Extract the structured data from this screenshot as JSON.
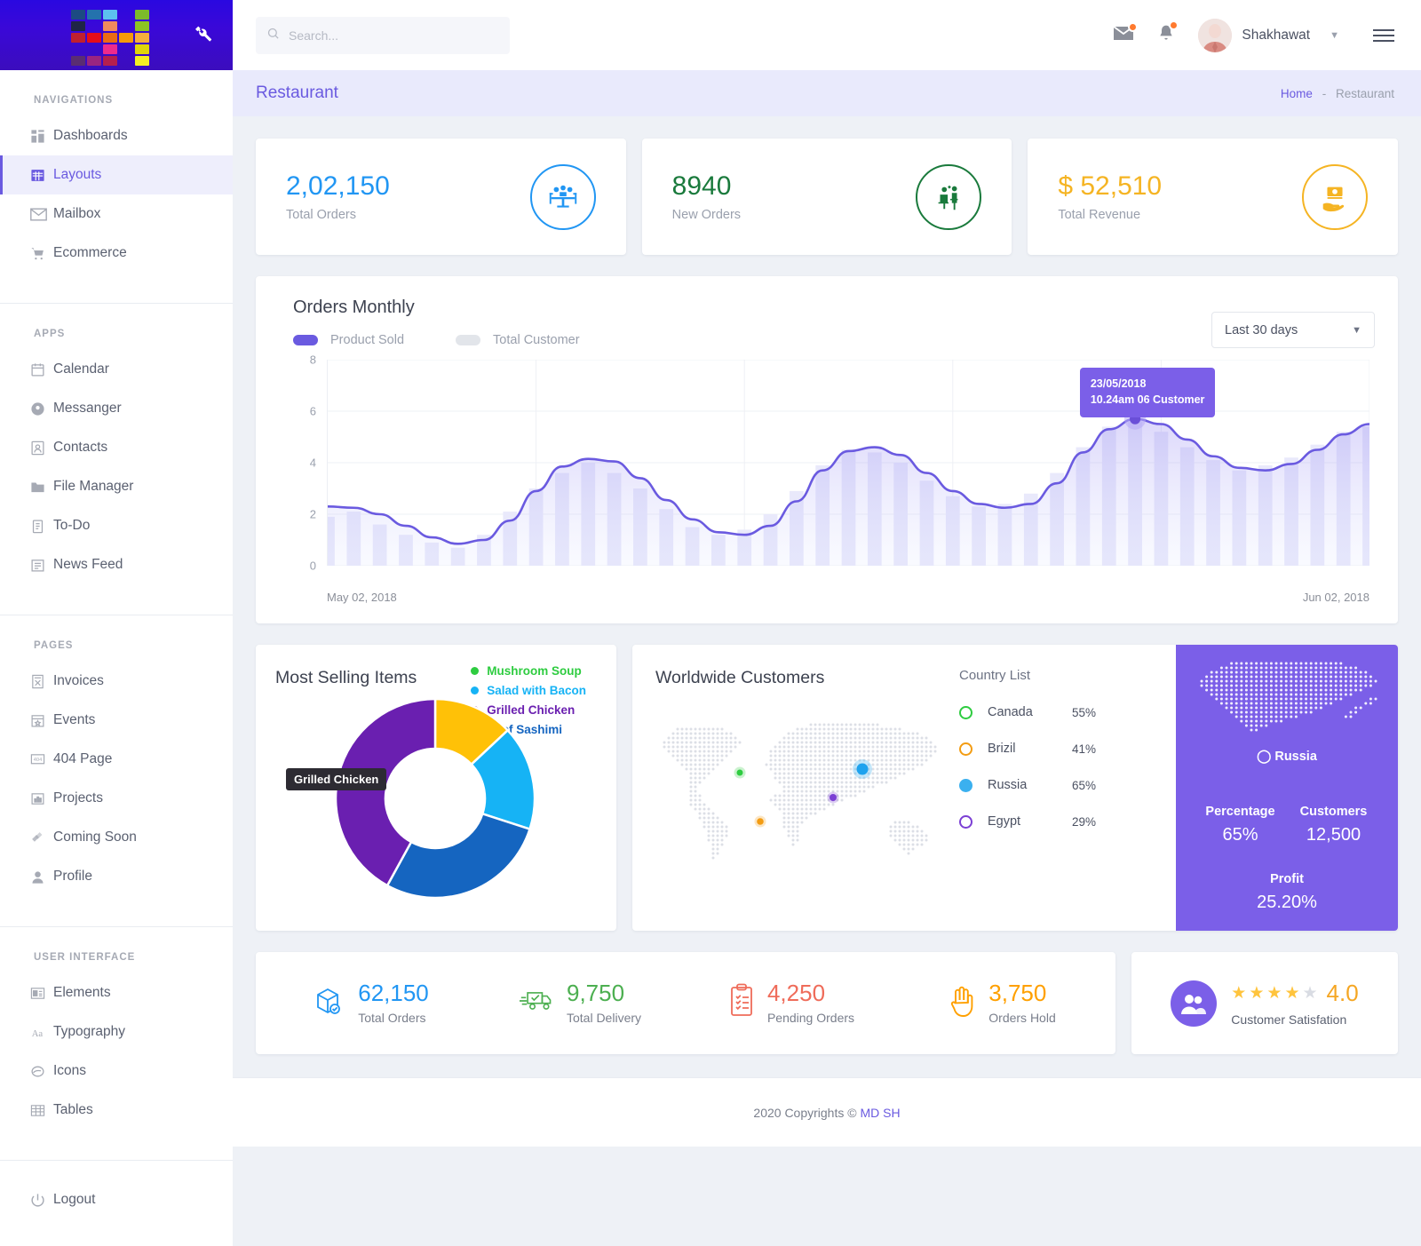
{
  "brand": {
    "logo_name": "logo-grid",
    "wrench": "✕"
  },
  "sidebar": {
    "sections": [
      {
        "label": "NAVIGATIONS",
        "items": [
          {
            "label": "Dashboards",
            "icon": "dashboard-icon",
            "active": false
          },
          {
            "label": "Layouts",
            "icon": "layouts-icon",
            "active": true
          },
          {
            "label": "Mailbox",
            "icon": "mail-icon",
            "active": false
          },
          {
            "label": "Ecommerce",
            "icon": "cart-icon",
            "active": false
          }
        ]
      },
      {
        "label": "APPS",
        "items": [
          {
            "label": "Calendar",
            "icon": "calendar-icon",
            "active": false
          },
          {
            "label": "Messanger",
            "icon": "messenger-icon",
            "active": false
          },
          {
            "label": "Contacts",
            "icon": "contacts-icon",
            "active": false
          },
          {
            "label": "File Manager",
            "icon": "folder-icon",
            "active": false
          },
          {
            "label": "To-Do",
            "icon": "todo-icon",
            "active": false
          },
          {
            "label": "News Feed",
            "icon": "news-icon",
            "active": false
          }
        ]
      },
      {
        "label": "PAGES",
        "items": [
          {
            "label": "Invoices",
            "icon": "invoice-icon",
            "active": false
          },
          {
            "label": "Events",
            "icon": "events-icon",
            "active": false
          },
          {
            "label": "404 Page",
            "icon": "error-page-icon",
            "active": false
          },
          {
            "label": "Projects",
            "icon": "projects-icon",
            "active": false
          },
          {
            "label": "Coming Soon",
            "icon": "coming-soon-icon",
            "active": false
          },
          {
            "label": "Profile",
            "icon": "profile-icon",
            "active": false
          }
        ]
      },
      {
        "label": "USER INTERFACE",
        "items": [
          {
            "label": "Elements",
            "icon": "elements-icon",
            "active": false
          },
          {
            "label": "Typography",
            "icon": "typography-icon",
            "active": false
          },
          {
            "label": "Icons",
            "icon": "icons-icon",
            "active": false
          },
          {
            "label": "Tables",
            "icon": "tables-icon",
            "active": false
          }
        ]
      }
    ],
    "logout": {
      "label": "Logout",
      "icon": "power-icon"
    }
  },
  "topbar": {
    "search_placeholder": "Search...",
    "search_value": "",
    "mail_icon": "envelope-icon",
    "bell_icon": "bell-icon",
    "user_name": "Shakhawat",
    "caret": "▼",
    "menu_icon": "hamburger-icon"
  },
  "pagehead": {
    "title": "Restaurant",
    "breadcrumb_home": "Home",
    "breadcrumb_sep": "-",
    "breadcrumb_current": "Restaurant"
  },
  "stat_cards": [
    {
      "value": "2,02,150",
      "label": "Total Orders",
      "color": "#2196f3",
      "icon": "dining-table-icon"
    },
    {
      "value": "8940",
      "label": "New Orders",
      "color": "#1a7a3c",
      "icon": "waiter-icon"
    },
    {
      "value": "$ 52,510",
      "label": "Total Revenue",
      "color": "#f5b423",
      "icon": "money-hand-icon"
    }
  ],
  "orders_monthly": {
    "title": "Orders Monthly",
    "legend": [
      {
        "label": "Product Sold",
        "color": "#6a5ae0"
      },
      {
        "label": "Total Customer",
        "color": "#e2e5ea"
      }
    ],
    "range_label": "Last 30 days",
    "range_caret": "▼",
    "tooltip": {
      "date": "23/05/2018",
      "detail": "10.24am  06 Customer"
    },
    "start_date": "May 02, 2018",
    "end_date": "Jun 02, 2018"
  },
  "chart_data": [
    {
      "type": "area",
      "title": "Orders Monthly",
      "xlabel": "",
      "ylabel": "",
      "ylim": [
        0,
        8
      ],
      "yticks": [
        0,
        2,
        4,
        6,
        8
      ],
      "grid": true,
      "legend_position": "top-left",
      "x": [
        "May 02, 2018",
        "Jun 02, 2018"
      ],
      "series": [
        {
          "name": "Product Sold",
          "color": "#6a5ae0",
          "values": [
            2.3,
            2.25,
            2.0,
            1.55,
            1.1,
            0.85,
            1.0,
            1.75,
            2.9,
            3.85,
            4.15,
            4.05,
            3.4,
            2.55,
            1.8,
            1.3,
            1.2,
            1.55,
            2.5,
            3.7,
            4.45,
            4.6,
            4.3,
            3.6,
            2.9,
            2.4,
            2.25,
            2.4,
            3.2,
            4.4,
            5.3,
            5.7,
            5.5,
            4.9,
            4.25,
            3.8,
            3.7,
            3.95,
            4.5,
            5.1,
            5.5
          ]
        },
        {
          "name": "Total Customer",
          "color": "#e2e5ea",
          "values": [
            1.9,
            2.1,
            1.6,
            1.2,
            0.9,
            0.7,
            1.2,
            2.1,
            3.0,
            3.6,
            4.0,
            3.6,
            3.0,
            2.2,
            1.5,
            1.2,
            1.4,
            2.0,
            2.9,
            3.9,
            4.5,
            4.4,
            4.0,
            3.3,
            2.7,
            2.3,
            2.4,
            2.8,
            3.6,
            4.6,
            5.4,
            5.6,
            5.2,
            4.6,
            4.1,
            3.7,
            3.9,
            4.2,
            4.7,
            5.2,
            5.4
          ]
        }
      ],
      "annotation": {
        "x_index": 31,
        "y": 5.7,
        "text": "23/05/2018 10.24am  06 Customer"
      }
    },
    {
      "type": "pie",
      "title": "Most Selling Items",
      "donut": true,
      "labels": [
        "Mushroom Soup",
        "Salad with Bacon",
        "Grilled Chicken",
        "Beef Sashimi"
      ],
      "values": [
        13,
        17,
        42,
        28
      ],
      "colors": [
        "#ffc107",
        "#16b3f5",
        "#6a1fb0",
        "#1565c0"
      ],
      "legend_colors": [
        "#2ecc40",
        "#16b3f5",
        "#6a1fb0",
        "#1565c0"
      ],
      "legend_position": "top-right",
      "annotation": "Grilled Chicken"
    },
    {
      "type": "table",
      "title": "Worldwide Customers",
      "columns": [
        "Country",
        "Percentage"
      ],
      "rows": [
        [
          "Canada",
          "55%"
        ],
        [
          "Brizil",
          "41%"
        ],
        [
          "Russia",
          "65%"
        ],
        [
          "Egypt",
          "29%"
        ]
      ],
      "colors": [
        "#2ecc40",
        "#f39c12",
        "#3bb0ef",
        "#7b3fd4"
      ]
    }
  ],
  "most_selling": {
    "title": "Most Selling Items",
    "tooltip": "Grilled Chicken",
    "legend": [
      {
        "label": "Mushroom Soup",
        "color": "#2ecc40"
      },
      {
        "label": "Salad with Bacon",
        "color": "#16b3f5"
      },
      {
        "label": "Grilled Chicken",
        "color": "#6a1fb0"
      },
      {
        "label": "Beef Sashimi",
        "color": "#1565c0"
      }
    ]
  },
  "worldwide": {
    "title": "Worldwide Customers",
    "country_list_title": "Country List",
    "countries": [
      {
        "name": "Canada",
        "pct": "55%",
        "color": "#2ecc40",
        "filled": false
      },
      {
        "name": "Brizil",
        "pct": "41%",
        "color": "#f39c12",
        "filled": false
      },
      {
        "name": "Russia",
        "pct": "65%",
        "color": "#3bb0ef",
        "filled": true
      },
      {
        "name": "Egypt",
        "pct": "29%",
        "color": "#7b3fd4",
        "filled": false
      }
    ],
    "panel": {
      "country": "Russia",
      "marker": "◯",
      "percentage_label": "Percentage",
      "percentage_value": "65%",
      "customers_label": "Customers",
      "customers_value": "12,500",
      "profit_label": "Profit",
      "profit_value": "25.20%"
    }
  },
  "bottom_stats": [
    {
      "value": "62,150",
      "label": "Total Orders",
      "color": "#2196f3",
      "icon": "package-icon"
    },
    {
      "value": "9,750",
      "label": "Total Delivery",
      "color": "#4caf50",
      "icon": "truck-icon"
    },
    {
      "value": "4,250",
      "label": "Pending Orders",
      "color": "#ef6c5a",
      "icon": "clipboard-icon"
    },
    {
      "value": "3,750",
      "label": "Orders Hold",
      "color": "#ffa000",
      "icon": "hand-icon"
    }
  ],
  "satisfaction": {
    "icon": "users-icon",
    "rating_value": "4.0",
    "stars_filled": 4,
    "stars_total": 5,
    "label": "Customer Satisfation"
  },
  "footer": {
    "text": "2020 Copyrights ©",
    "link": "MD SH"
  }
}
